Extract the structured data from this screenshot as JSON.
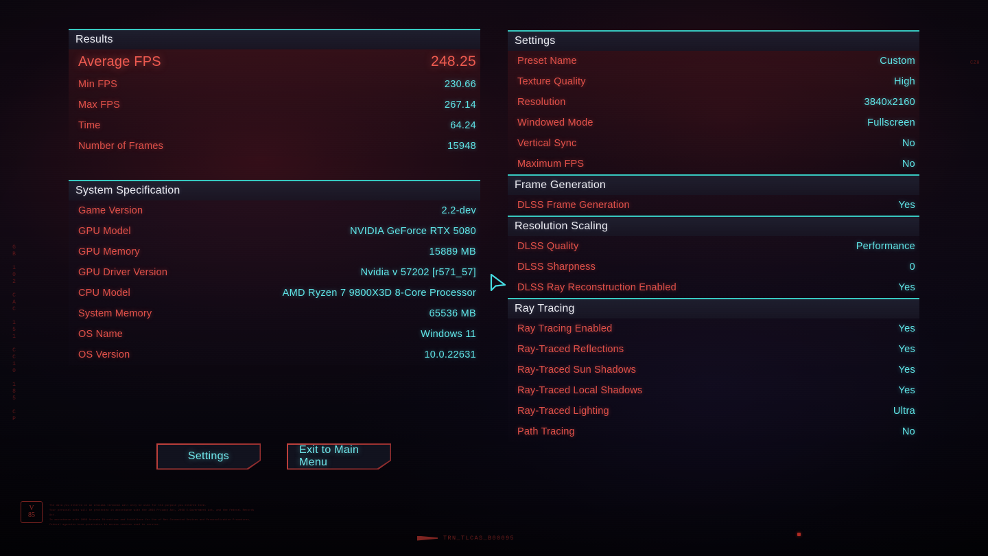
{
  "left_panel": {
    "results": {
      "title": "Results",
      "rows": [
        {
          "label": "Average FPS",
          "value": "248.25",
          "highlight": true
        },
        {
          "label": "Min FPS",
          "value": "230.66"
        },
        {
          "label": "Max FPS",
          "value": "267.14"
        },
        {
          "label": "Time",
          "value": "64.24"
        },
        {
          "label": "Number of Frames",
          "value": "15948"
        }
      ]
    },
    "system_specification": {
      "title": "System Specification",
      "rows": [
        {
          "label": "Game Version",
          "value": "2.2-dev"
        },
        {
          "label": "GPU Model",
          "value": "NVIDIA GeForce RTX 5080"
        },
        {
          "label": "GPU Memory",
          "value": "15889 MB"
        },
        {
          "label": "GPU Driver Version",
          "value": "Nvidia v 57202 [r571_57]"
        },
        {
          "label": "CPU Model",
          "value": "AMD Ryzen 7 9800X3D 8-Core Processor"
        },
        {
          "label": "System Memory",
          "value": "65536 MB"
        },
        {
          "label": "OS Name",
          "value": "Windows 11"
        },
        {
          "label": "OS Version",
          "value": "10.0.22631"
        }
      ]
    }
  },
  "right_panel": {
    "settings": {
      "title": "Settings",
      "rows": [
        {
          "label": "Preset Name",
          "value": "Custom"
        },
        {
          "label": "Texture Quality",
          "value": "High"
        },
        {
          "label": "Resolution",
          "value": "3840x2160"
        },
        {
          "label": "Windowed Mode",
          "value": "Fullscreen"
        },
        {
          "label": "Vertical Sync",
          "value": "No"
        },
        {
          "label": "Maximum FPS",
          "value": "No"
        }
      ]
    },
    "frame_generation": {
      "title": "Frame Generation",
      "rows": [
        {
          "label": "DLSS Frame Generation",
          "value": "Yes"
        }
      ]
    },
    "resolution_scaling": {
      "title": "Resolution Scaling",
      "rows": [
        {
          "label": "DLSS Quality",
          "value": "Performance"
        },
        {
          "label": "DLSS Sharpness",
          "value": "0"
        },
        {
          "label": "DLSS Ray Reconstruction Enabled",
          "value": "Yes"
        }
      ]
    },
    "ray_tracing": {
      "title": "Ray Tracing",
      "rows": [
        {
          "label": "Ray Tracing Enabled",
          "value": "Yes"
        },
        {
          "label": "Ray-Traced Reflections",
          "value": "Yes"
        },
        {
          "label": "Ray-Traced Sun Shadows",
          "value": "Yes"
        },
        {
          "label": "Ray-Traced Local Shadows",
          "value": "Yes"
        },
        {
          "label": "Ray-Traced Lighting",
          "value": "Ultra"
        },
        {
          "label": "Path Tracing",
          "value": "No"
        }
      ]
    }
  },
  "buttons": {
    "settings_label": "Settings",
    "exit_label": "Exit to Main Menu"
  },
  "chrome": {
    "left_vertical_code": "GB 102 CAC 151 CC10 185 CP",
    "badge_line1": "V",
    "badge_line2": "85",
    "legal_lines": [
      "The data you entered on an Arasaka terminal will only be used for the purpose you entered them.",
      "Your personal data will be protected in accordance with the 2069 Privacy Act, 2068 E-Government Act, and the Federal Records Act.",
      "In accordance with 2069 Arasaka Directives and Guidelines for Use of Net-Connected Devices and Personalization Procedures, federal agencies have permission to access cookies used in service."
    ],
    "build_tag": "TRN_TLCAS_B00095",
    "corner_mark": "CZH"
  },
  "colors": {
    "label_red": "#e05049",
    "value_cyan": "#5fe3e6",
    "accent_teal": "#37c8c0",
    "highlight_red": "#ee5a50",
    "header_text": "#e9e9ef",
    "button_border": "#c0413c"
  }
}
